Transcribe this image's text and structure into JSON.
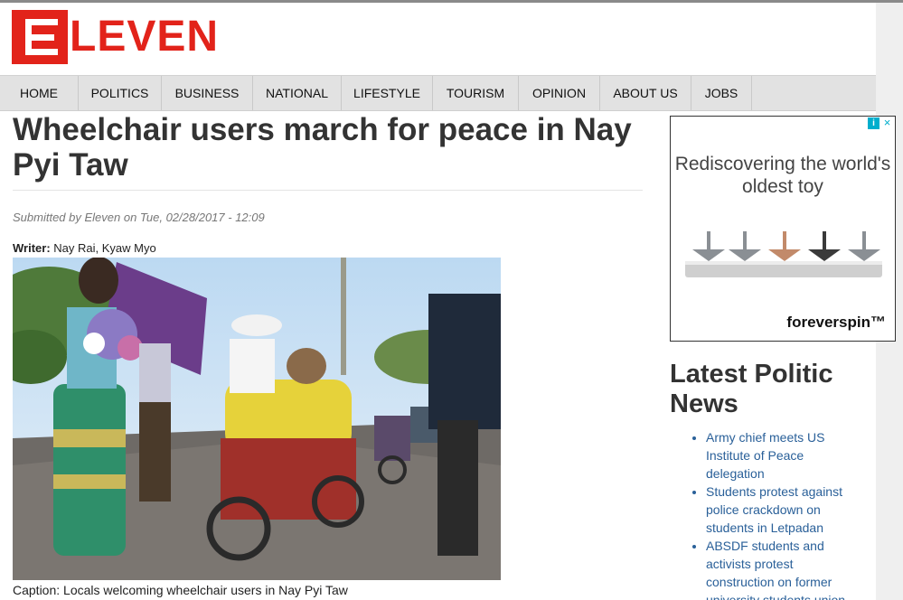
{
  "site": {
    "logo_text": "LEVEN",
    "logo_letter": "E",
    "brand_color": "#e2231a"
  },
  "nav": {
    "items": [
      {
        "label": "HOME"
      },
      {
        "label": "POLITICS"
      },
      {
        "label": "BUSINESS"
      },
      {
        "label": "NATIONAL"
      },
      {
        "label": "LIFESTYLE"
      },
      {
        "label": "TOURISM"
      },
      {
        "label": "OPINION"
      },
      {
        "label": "ABOUT US"
      },
      {
        "label": "JOBS"
      }
    ]
  },
  "article": {
    "title": "Wheelchair users march for peace in Nay Pyi Taw",
    "submitted": "Submitted by Eleven on Tue, 02/28/2017 - 12:09",
    "writer_label": "Writer:",
    "writer": "Nay Rai, Kyaw Myo",
    "caption": "Caption: Locals welcoming wheelchair users in Nay Pyi Taw"
  },
  "ad": {
    "headline": "Rediscovering the world's oldest toy",
    "brand": "foreverspin™",
    "info_icon": "i",
    "close_icon": "×"
  },
  "sidebar": {
    "title": "Latest Politic News",
    "items": [
      {
        "label": "Army chief meets US Institute of Peace delegation"
      },
      {
        "label": "Students protest against police crackdown on students in Letpadan"
      },
      {
        "label": "ABSDF students and activists protest construction on former university students union"
      }
    ]
  }
}
